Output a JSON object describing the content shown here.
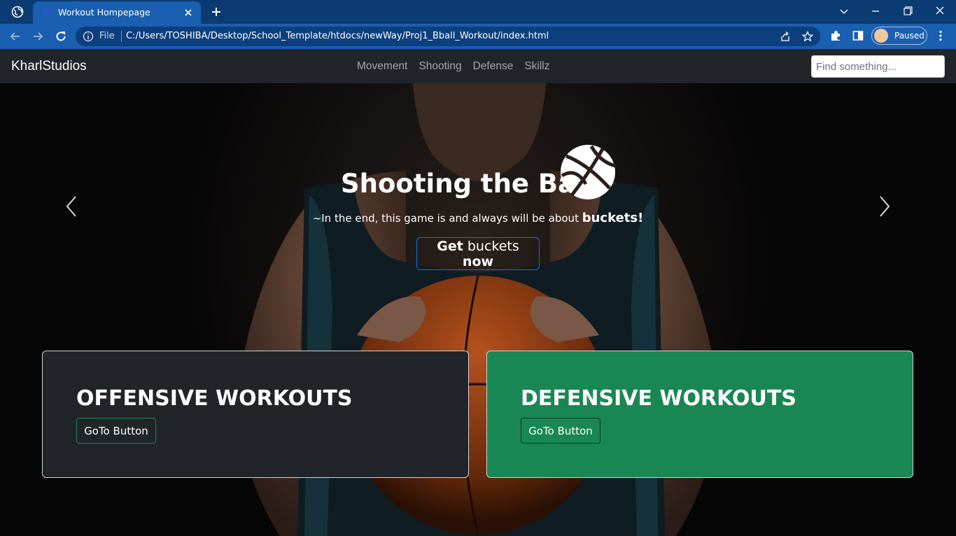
{
  "browser": {
    "tab_title": "Workout Hompepage",
    "file_label": "File",
    "url": "C:/Users/TOSHIBA/Desktop/School_Template/htdocs/newWay/Proj1_Bball_Workout/index.html",
    "profile_status": "Paused"
  },
  "navbar": {
    "brand": "KharlStudios",
    "links": [
      "Movement",
      "Shooting",
      "Defense",
      "Skillz"
    ],
    "search_placeholder": "Find something..."
  },
  "hero": {
    "title": "Shooting the Ball",
    "subtitle_prefix": "~In the end, this game is and always will be about ",
    "subtitle_bold": "buckets!",
    "button": {
      "part1": "Get",
      "part2": " buckets ",
      "part3": "now"
    }
  },
  "cards": [
    {
      "title": "OFFENSIVE WORKOUTS",
      "button": "GoTo Button"
    },
    {
      "title": "DEFENSIVE WORKOUTS",
      "button": "GoTo Button"
    }
  ],
  "colors": {
    "navbar_bg": "#212529",
    "card_dark": "#212529",
    "card_green": "#198754",
    "hero_button_border": "#0d6efd",
    "browser_tab": "#1a5fb0"
  }
}
